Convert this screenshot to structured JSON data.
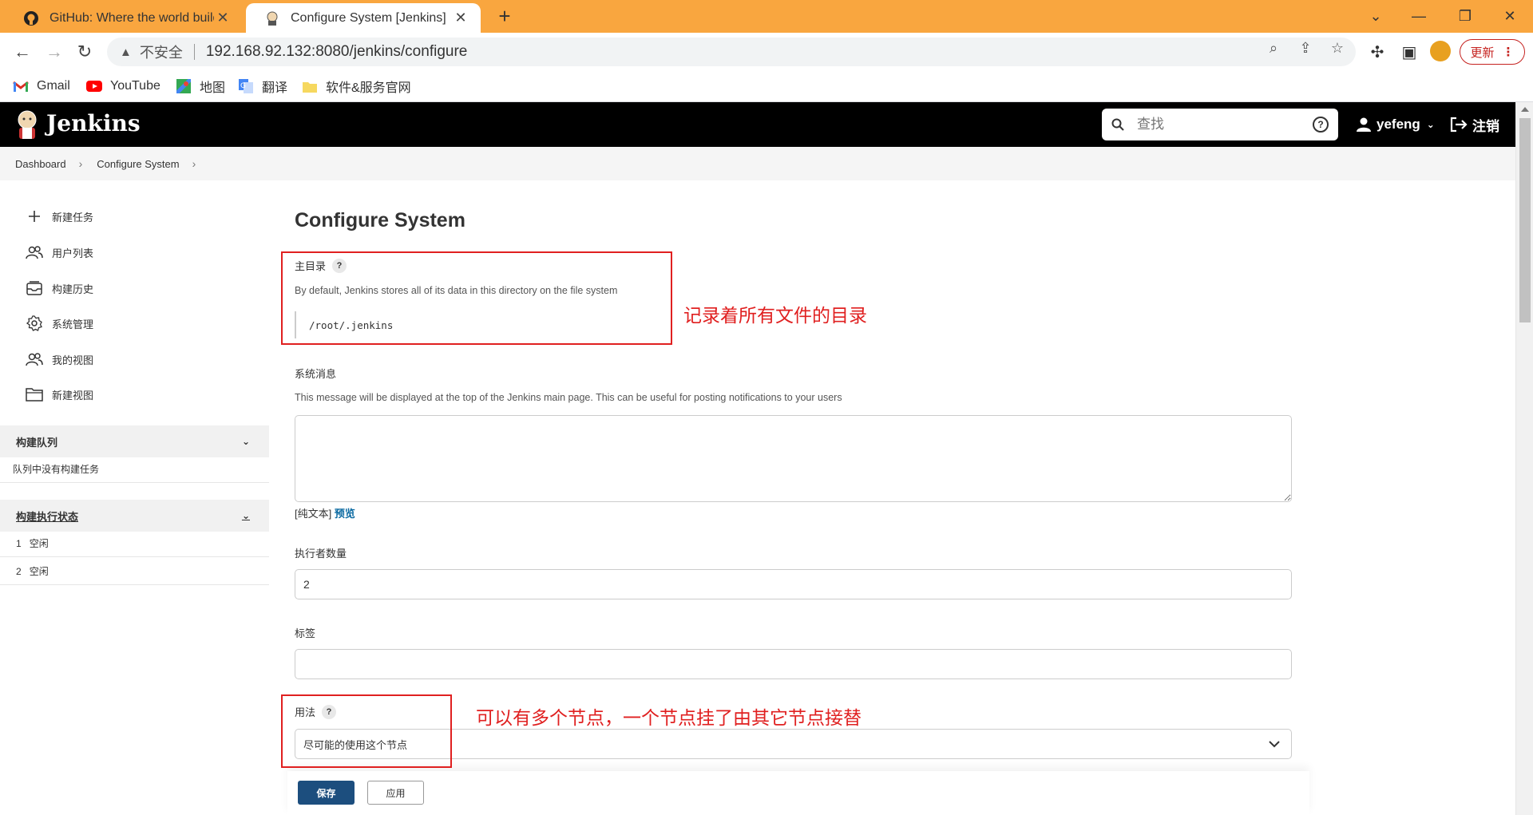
{
  "browser": {
    "tabs": [
      {
        "title": "GitHub: Where the world build",
        "icon": "github-icon"
      },
      {
        "title": "Configure System [Jenkins]",
        "icon": "jenkins-icon"
      }
    ],
    "new_tab": "+",
    "address": {
      "security_label": "不安全",
      "url": "192.168.92.132:8080/jenkins/configure"
    },
    "update_label": "更新",
    "bookmarks": [
      {
        "label": "Gmail",
        "icon": "gmail-icon"
      },
      {
        "label": "YouTube",
        "icon": "youtube-icon"
      },
      {
        "label": "地图",
        "icon": "maps-icon"
      },
      {
        "label": "翻译",
        "icon": "translate-icon"
      },
      {
        "label": "软件&服务官网",
        "icon": "folder-icon"
      }
    ]
  },
  "jenkins": {
    "brand": "Jenkins",
    "search_placeholder": "查找",
    "user": "yefeng",
    "logout": "注销"
  },
  "breadcrumb": [
    "Dashboard",
    "Configure System"
  ],
  "sidebar": {
    "items": [
      {
        "label": "新建任务",
        "icon": "plus-icon"
      },
      {
        "label": "用户列表",
        "icon": "users-icon"
      },
      {
        "label": "构建历史",
        "icon": "history-icon"
      },
      {
        "label": "系统管理",
        "icon": "gear-icon"
      },
      {
        "label": "我的视图",
        "icon": "users-icon"
      },
      {
        "label": "新建视图",
        "icon": "folder-icon"
      }
    ],
    "queue": {
      "title": "构建队列",
      "empty": "队列中没有构建任务"
    },
    "executors": {
      "title": "构建执行状态",
      "rows": [
        {
          "num": "1",
          "status": "空闲"
        },
        {
          "num": "2",
          "status": "空闲"
        }
      ]
    }
  },
  "main": {
    "title": "Configure System",
    "home_dir": {
      "label": "主目录",
      "description": "By default, Jenkins stores all of its data in this directory on the file system",
      "value": "/root/.jenkins"
    },
    "system_message": {
      "label": "系统消息",
      "description": "This message will be displayed at the top of the Jenkins main page. This can be useful for posting notifications to your users",
      "value": "",
      "plain_text": "[纯文本]",
      "preview": "预览"
    },
    "executors": {
      "label": "执行者数量",
      "value": "2"
    },
    "labels": {
      "label": "标签",
      "value": ""
    },
    "usage": {
      "label": "用法",
      "selected": "尽可能的使用这个节点"
    },
    "save": "保存",
    "apply": "应用"
  },
  "annotations": {
    "home_note": "记录着所有文件的目录",
    "usage_note": "可以有多个节点，一个节点挂了由其它节点接替",
    "color": "#e02020"
  }
}
